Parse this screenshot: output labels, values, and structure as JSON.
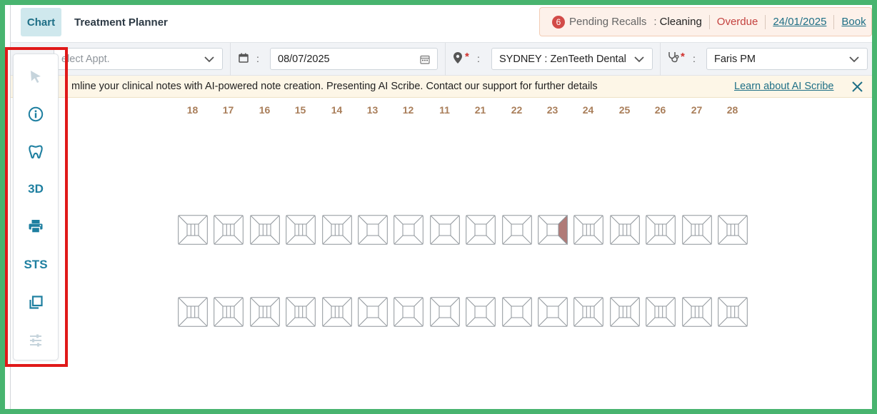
{
  "header": {
    "tabs": [
      {
        "label": "Chart",
        "active": true
      },
      {
        "label": "Treatment Planner",
        "active": false
      }
    ],
    "recall": {
      "count": "6",
      "label": "Pending Recalls",
      "separator": ":",
      "type": "Cleaning",
      "status": "Overdue",
      "date": "24/01/2025",
      "action": "Book"
    }
  },
  "filters": {
    "appointment": {
      "placeholder": "elect Appt."
    },
    "date": {
      "separator": ":",
      "value": "08/07/2025"
    },
    "location": {
      "required_mark": "*",
      "separator": ":",
      "value": "SYDNEY : ZenTeeth Dental"
    },
    "provider": {
      "required_mark": "*",
      "separator": ":",
      "value": "Faris PM"
    }
  },
  "notice": {
    "text": "mline your clinical notes with AI-powered note creation. Presenting AI Scribe. Contact our support for further details",
    "link": "Learn about AI Scribe"
  },
  "toolbar": {
    "three_d_label": "3D",
    "sts_label": "STS"
  },
  "chart": {
    "tooth_numbers": [
      "18",
      "17",
      "16",
      "15",
      "14",
      "13",
      "12",
      "11",
      "21",
      "22",
      "23",
      "24",
      "25",
      "26",
      "27",
      "28"
    ],
    "marked_tooth": "23",
    "marked_surface": "distal",
    "marked_color": "#b07a77"
  },
  "colors": {
    "accent": "#1e7fa0",
    "outline_highlight": "#e01919",
    "frame": "#48b46f"
  }
}
